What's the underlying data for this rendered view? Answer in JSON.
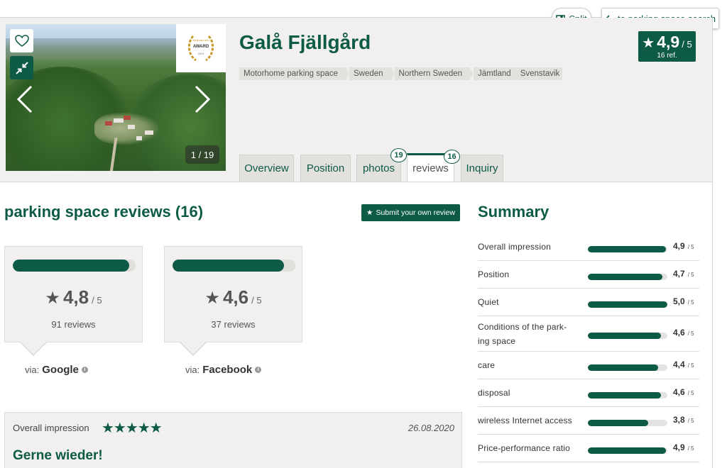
{
  "colors": {
    "brand": "#0d5a46",
    "panel": "#f1f0ee",
    "tab": "#e2e1de"
  },
  "toolbar": {
    "split_label": "Split",
    "back_label": "to parking space search"
  },
  "listing": {
    "title": "Galå Fjällgård",
    "breadcrumbs": [
      "Motorhome parking space",
      "Sweden",
      "Northern Sweden",
      "Jämtland",
      "Svenstavik"
    ],
    "rating": "4,9",
    "rating_of": "/ 5",
    "rating_ref": "16 ref.",
    "photo_counter": "1 / 19",
    "award": {
      "small": "stellplatz.info",
      "main": "AWARD",
      "year": "2024"
    }
  },
  "tabs": [
    {
      "label": "Overview"
    },
    {
      "label": "Position"
    },
    {
      "label": "photos",
      "badge": "19"
    },
    {
      "label": "reviews",
      "badge": "16"
    },
    {
      "label": "Inquiry"
    }
  ],
  "reviews": {
    "title": "parking space reviews (16)",
    "submit_label": "Submit your own review",
    "sources": [
      {
        "score": "4,8",
        "of": "/ 5",
        "count": "91 reviews",
        "via": "via:",
        "name": "Google",
        "fill": 0.95
      },
      {
        "score": "4,6",
        "of": "/ 5",
        "count": "37 reviews",
        "via": "via:",
        "name": "Facebook",
        "fill": 0.91
      }
    ],
    "first": {
      "label": "Overall impression",
      "stars": "★★★★★",
      "date": "26.08.2020",
      "title": "Gerne wieder!"
    }
  },
  "summary": {
    "title": "Summary",
    "of": "/ 5",
    "rows": [
      {
        "label": "Overall impression",
        "value": "4,9",
        "fill": 0.98
      },
      {
        "label": "Position",
        "value": "4,7",
        "fill": 0.94
      },
      {
        "label": "Quiet",
        "value": "5,0",
        "fill": 1.0
      },
      {
        "label": "Conditions of the park-ing space",
        "value": "4,6",
        "fill": 0.92
      },
      {
        "label": "care",
        "value": "4,4",
        "fill": 0.88
      },
      {
        "label": "disposal",
        "value": "4,6",
        "fill": 0.92
      },
      {
        "label": "wireless Internet access",
        "value": "3,8",
        "fill": 0.76
      },
      {
        "label": "Price-performance ratio",
        "value": "4,9",
        "fill": 0.98
      }
    ]
  },
  "icons": {
    "heart": "heart-icon",
    "compress": "compress-icon",
    "star": "star-icon",
    "split": "split-view-icon",
    "back": "arrow-left-icon",
    "info": "info-icon"
  }
}
